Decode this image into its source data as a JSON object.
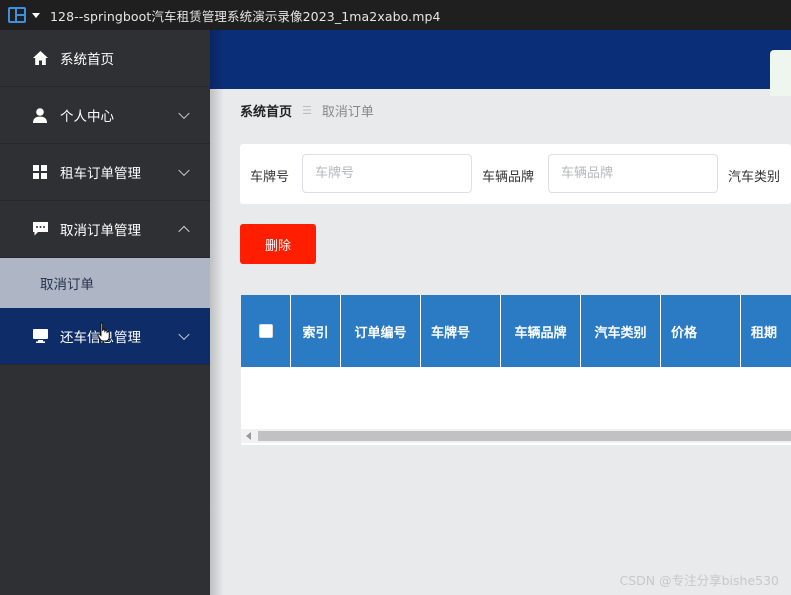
{
  "window": {
    "title": "128--springboot汽车租赁管理系统演示录像2023_1ma2xabo.mp4"
  },
  "sidebar": {
    "items": [
      {
        "label": "系统首页",
        "icon": "home-icon"
      },
      {
        "label": "个人中心",
        "icon": "user-icon"
      },
      {
        "label": "租车订单管理",
        "icon": "grid-icon"
      },
      {
        "label": "取消订单管理",
        "icon": "message-icon"
      },
      {
        "label": "还车信息管理",
        "icon": "monitor-icon"
      }
    ],
    "submenu": {
      "label": "取消订单"
    }
  },
  "breadcrumb": {
    "home": "系统首页",
    "separator": "☰",
    "current": "取消订单"
  },
  "search": {
    "plate_label": "车牌号",
    "plate_placeholder": "车牌号",
    "brand_label": "车辆品牌",
    "brand_placeholder": "车辆品牌",
    "type_label": "汽车类别"
  },
  "toolbar": {
    "delete_label": "删除"
  },
  "table": {
    "columns": [
      "索引",
      "订单编号",
      "车牌号",
      "车辆品牌",
      "汽车类别",
      "价格",
      "租期"
    ]
  },
  "watermark": "CSDN @专注分享bishe530",
  "colors": {
    "sidebar_bg": "#2f3033",
    "header_bg": "#0b2e78",
    "table_header": "#2b7ac4",
    "danger": "#ff1f00"
  }
}
